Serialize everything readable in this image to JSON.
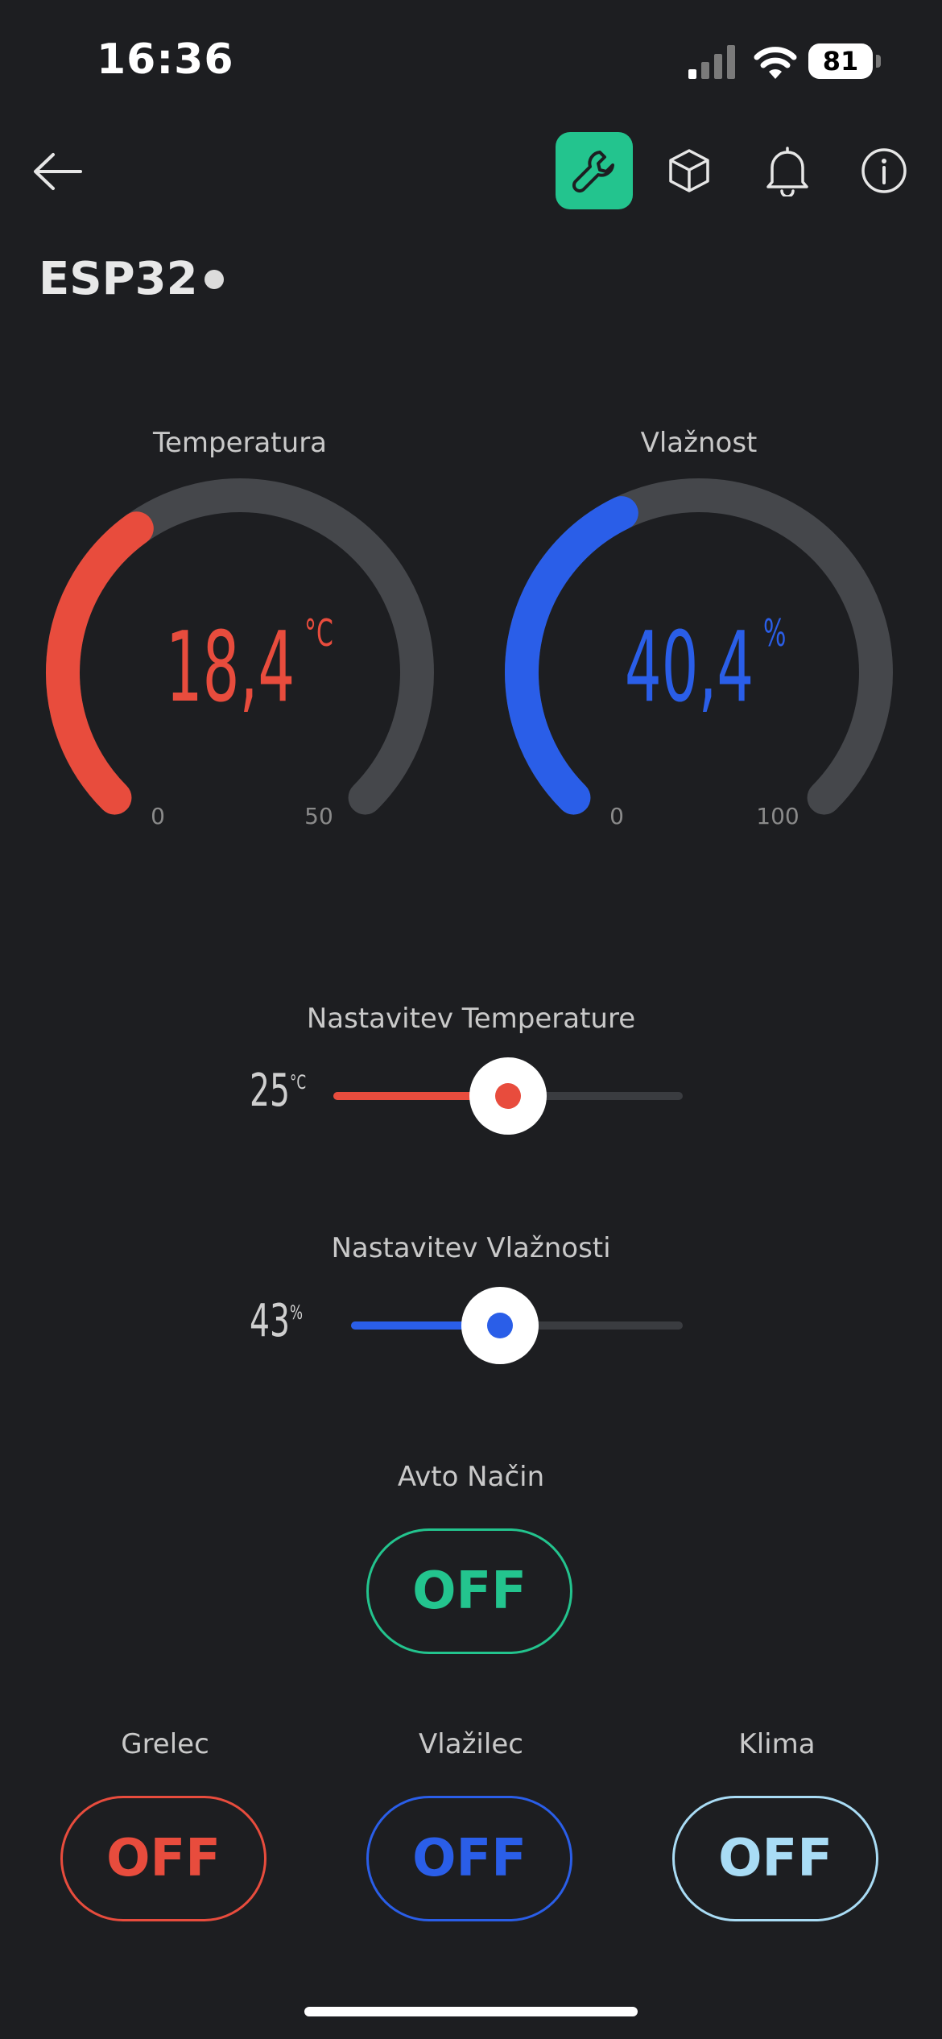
{
  "status_bar": {
    "time": "16:36",
    "battery": "81"
  },
  "toolbar": {
    "icons": [
      "back-arrow-icon",
      "wrench-icon",
      "cube-icon",
      "bell-icon",
      "info-icon"
    ],
    "active_color": "#23c48e"
  },
  "device": {
    "name": "ESP32"
  },
  "gauges": [
    {
      "label": "Temperatura",
      "value": "18,4",
      "unit": "°C",
      "min": "0",
      "max": "50",
      "fraction": 0.368,
      "color": "#e84c3d"
    },
    {
      "label": "Vlažnost",
      "value": "40,4",
      "unit": "%",
      "min": "0",
      "max": "100",
      "fraction": 0.404,
      "color": "#2a5ee8"
    }
  ],
  "sliders": [
    {
      "label": "Nastavitev Temperature",
      "value": "25",
      "unit": "°C",
      "fraction": 0.5,
      "color": "#e84c3d"
    },
    {
      "label": "Nastavitev Vlažnosti",
      "value": "43",
      "unit": "%",
      "fraction": 0.45,
      "color": "#2a5ee8"
    }
  ],
  "auto_mode": {
    "label": "Avto Način",
    "state": "OFF",
    "color": "#23c48e"
  },
  "switches": [
    {
      "label": "Grelec",
      "state": "OFF",
      "color": "#e84c3d"
    },
    {
      "label": "Vlažilec",
      "state": "OFF",
      "color": "#2a5ee8"
    },
    {
      "label": "Klima",
      "state": "OFF",
      "color": "#a9dcf5"
    }
  ]
}
